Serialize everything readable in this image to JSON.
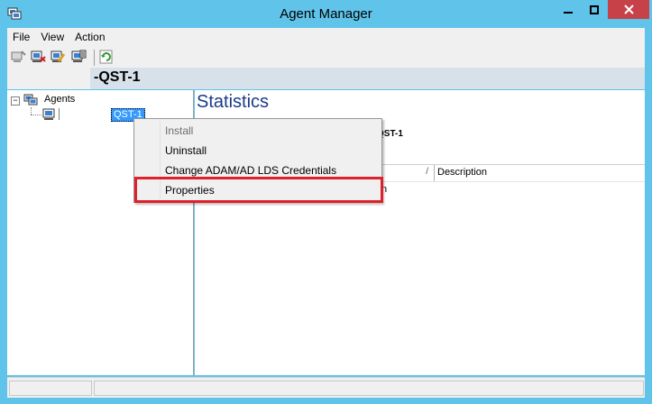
{
  "window": {
    "title": "Agent Manager",
    "min_glyph": "▬",
    "max_glyph": "☐",
    "close_glyph": "✕"
  },
  "menu": {
    "items": [
      {
        "label": "File"
      },
      {
        "label": "View"
      },
      {
        "label": "Action"
      }
    ]
  },
  "toolbar": {
    "icons": [
      "agent-install-icon",
      "agent-uninstall-icon",
      "edit-credentials-icon",
      "properties-icon",
      "refresh-icon"
    ]
  },
  "header": {
    "title": "-QST-1"
  },
  "tree": {
    "root_label": "Agents",
    "expander": "−",
    "node_label": "QST-1"
  },
  "main": {
    "title": "Statistics",
    "agent_label": "QST-1",
    "columns": [
      "",
      "Description"
    ],
    "sort_arrow": "/",
    "row_fragment": "n"
  },
  "context_menu": {
    "items": [
      {
        "label": "Install",
        "enabled": false
      },
      {
        "label": "Uninstall",
        "enabled": true
      },
      {
        "label": "Change ADAM/AD LDS Credentials",
        "enabled": true
      },
      {
        "label": "Properties",
        "enabled": true,
        "highlighted": true
      }
    ]
  },
  "colors": {
    "frame": "#5fc3ea",
    "close_button": "#c74148",
    "highlight_border": "#e0202a",
    "selection": "#3399ff",
    "title_blue": "#1a3a8a"
  }
}
